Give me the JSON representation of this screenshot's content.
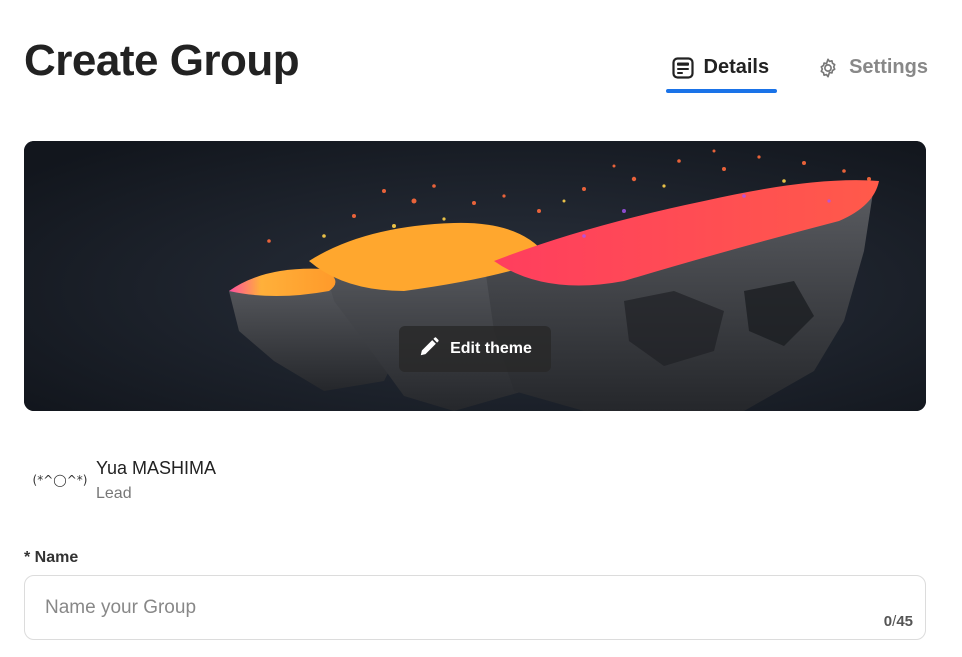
{
  "page": {
    "title": "Create Group"
  },
  "tabs": [
    {
      "label": "Details",
      "icon": "list-card-icon",
      "active": true
    },
    {
      "label": "Settings",
      "icon": "gear-icon",
      "active": false
    }
  ],
  "banner": {
    "edit_label": "Edit theme",
    "icon": "pencil-icon"
  },
  "member": {
    "avatar_text": "(*^◯^*)",
    "name": "Yua MASHIMA",
    "role": "Lead"
  },
  "form": {
    "name_label": "* Name",
    "name_placeholder": "Name your Group",
    "name_value": "",
    "counter_current": "0",
    "counter_max": "45"
  },
  "colors": {
    "accent": "#1a73e8",
    "banner_bg": "#151a22"
  }
}
